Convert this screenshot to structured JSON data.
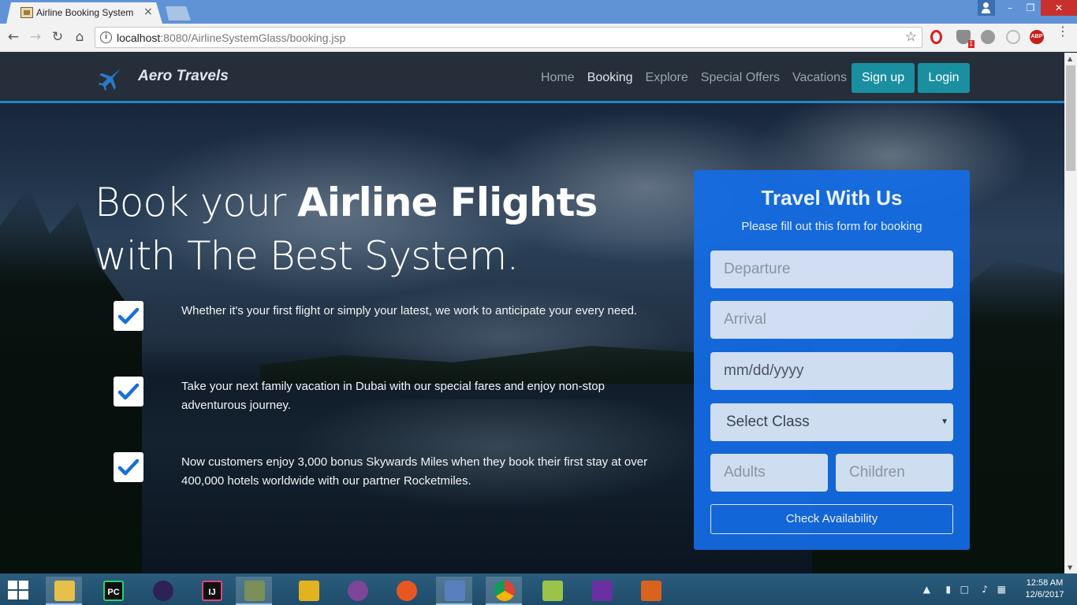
{
  "browser": {
    "tab_title": "Airline Booking System",
    "tab_close": "×",
    "url_host": "localhost",
    "url_path": ":8080/AirlineSystemGlass/booking.jsp",
    "info_glyph": "i",
    "shield_badge": "1",
    "abp_label": "ABP"
  },
  "nav": {
    "brand": "Aero Travels",
    "links": [
      "Home",
      "Booking",
      "Explore",
      "Special Offers",
      "Vacations"
    ],
    "active_link": "Booking",
    "signup": "Sign up",
    "login": "Login"
  },
  "hero": {
    "title_part1": "Book your ",
    "title_bold": "Airline Flights",
    "title_part2": " with The Best System.",
    "features": [
      "Whether it's your first flight or simply your latest, we work to anticipate your every need.",
      "Take your next family vacation in Dubai with our special fares and enjoy non-stop adventurous journey.",
      "Now customers enjoy 3,000 bonus Skywards Miles when they book their first stay at over 400,000 hotels worldwide with our partner Rocketmiles."
    ]
  },
  "booking_form": {
    "title": "Travel With Us",
    "subtitle": "Please fill out this form for booking",
    "departure_placeholder": "Departure",
    "arrival_placeholder": "Arrival",
    "date_placeholder": "mm/dd/yyyy",
    "class_selected": "Select Class",
    "adults_placeholder": "Adults",
    "children_placeholder": "Children",
    "submit": "Check Availability"
  },
  "taskbar": {
    "apps": [
      "file-explorer",
      "pycharm",
      "eclipse",
      "intellij",
      "tool-app",
      "vs-code-alt",
      "tor-browser",
      "firefox",
      "virtualbox",
      "chrome",
      "notepad-plus",
      "visual-studio",
      "matlab"
    ],
    "pycharm_label": "PC",
    "intellij_label": "IJ",
    "time": "12:58 AM",
    "date": "12/6/2017"
  },
  "colors": {
    "nav_accent": "#1e88c9",
    "button_teal": "#1a8fa0",
    "form_blue": "#136ce6"
  }
}
